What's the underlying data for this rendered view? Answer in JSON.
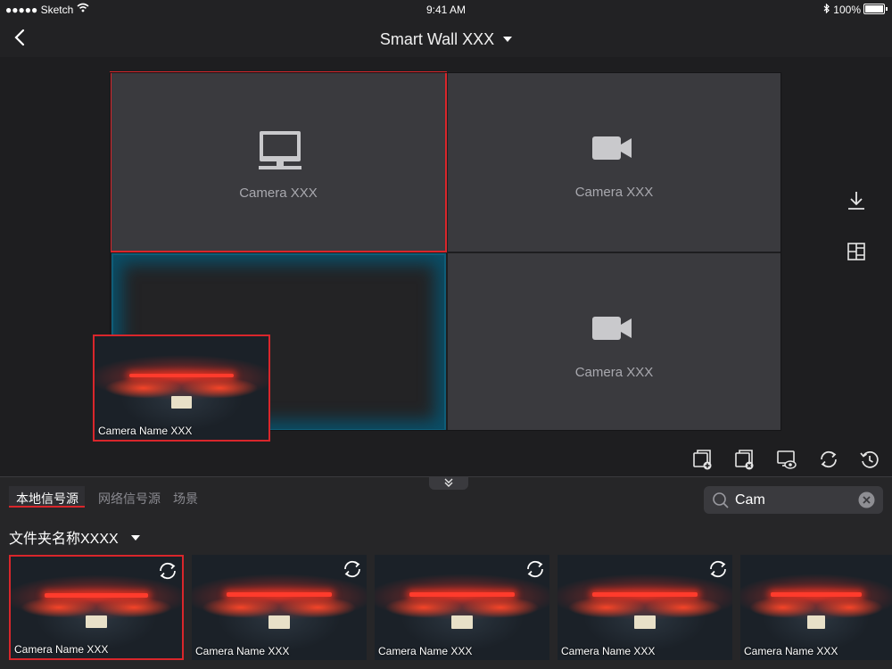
{
  "status_bar": {
    "carrier": "●●●●● Sketch",
    "time": "9:41 AM",
    "battery": "100%"
  },
  "nav": {
    "title": "Smart Wall XXX"
  },
  "wall": {
    "screens": [
      {
        "label": "Camera XXX",
        "icon": "monitor-icon"
      },
      {
        "label": "Camera XXX",
        "icon": "video-camera-icon"
      },
      {
        "label": "",
        "icon": ""
      },
      {
        "label": "Camera XXX",
        "icon": "video-camera-icon"
      }
    ],
    "preview_label": "Camera Name XXX"
  },
  "side_icons": [
    "download-icon",
    "layout-grid-icon"
  ],
  "toolbar": {
    "tools": [
      "add-window-icon",
      "remove-window-icon",
      "preview-eye-icon",
      "refresh-icon",
      "history-icon"
    ]
  },
  "panel": {
    "tabs": [
      "本地信号源",
      "网络信号源",
      "场景"
    ],
    "active_tab": "本地信号源",
    "search": {
      "value": "Cam"
    },
    "folder": "文件夹名称XXXX",
    "thumbnails": [
      {
        "label": "Camera Name XXX",
        "selected": true
      },
      {
        "label": "Camera Name XXX",
        "selected": false
      },
      {
        "label": "Camera Name XXX",
        "selected": false
      },
      {
        "label": "Camera Name XXX",
        "selected": false
      },
      {
        "label": "Camera Name XXX",
        "selected": false
      }
    ]
  },
  "colors": {
    "accent_red": "#d9262b",
    "highlight_blue": "#0a4e67",
    "background": "#1e1e20"
  }
}
